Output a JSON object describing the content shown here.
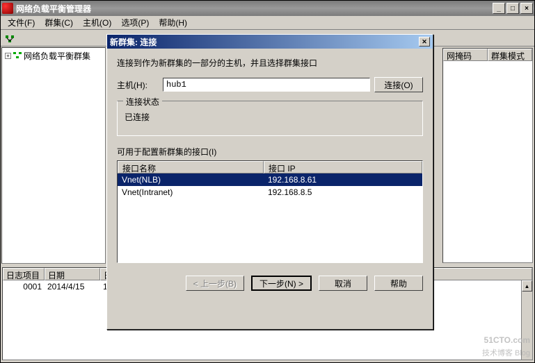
{
  "window": {
    "title": "网络负载平衡管理器",
    "min": "_",
    "max": "□",
    "close": "×"
  },
  "menu": {
    "file": "文件(F)",
    "cluster": "群集(C)",
    "host": "主机(O)",
    "options": "选项(P)",
    "help": "帮助(H)"
  },
  "tree": {
    "root": "网络负载平衡群集"
  },
  "right_cols": {
    "mask": "网掩码",
    "mode": "群集模式"
  },
  "log": {
    "cols": {
      "item": "日志项目",
      "date": "日期",
      "t": "日"
    },
    "rows": [
      {
        "item": "0001",
        "date": "2014/4/15",
        "t": "1"
      }
    ]
  },
  "dialog": {
    "title": "新群集:  连接",
    "instruction": "连接到作为新群集的一部分的主机，并且选择群集接口",
    "host_label": "主机(H):",
    "host_value": "hub1",
    "connect_btn": "连接(O)",
    "status_legend": "连接状态",
    "status_text": "已连接",
    "if_label": "可用于配置新群集的接口(I)",
    "cols": {
      "name": "接口名称",
      "ip": "接口 IP"
    },
    "rows": [
      {
        "name": "Vnet(NLB)",
        "ip": "192.168.8.61",
        "selected": true
      },
      {
        "name": "Vnet(Intranet)",
        "ip": "192.168.8.5",
        "selected": false
      }
    ],
    "back": "< 上一步(B)",
    "next": "下一步(N) >",
    "cancel": "取消",
    "help": "帮助"
  },
  "watermark": {
    "brand": "51CTO.com",
    "sub": "技术博客  Blog"
  }
}
